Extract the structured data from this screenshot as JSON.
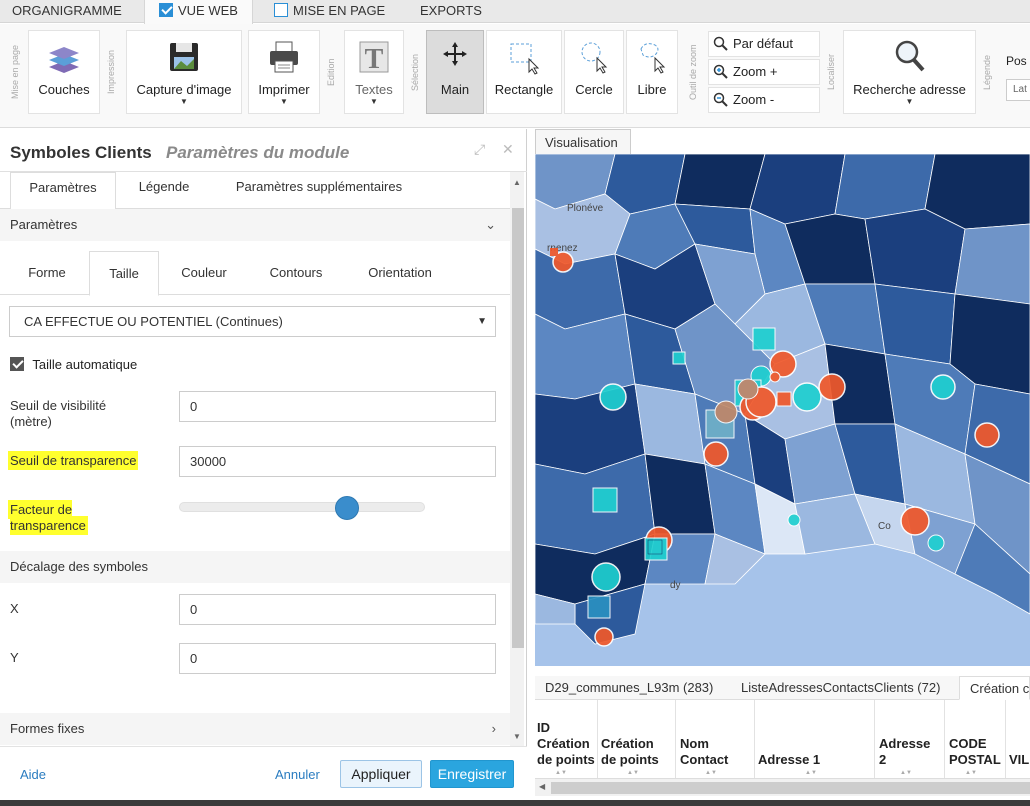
{
  "top_tabs": [
    {
      "label": "ORGANIGRAMME"
    },
    {
      "label": "VUE WEB"
    },
    {
      "label": "MISE EN PAGE"
    },
    {
      "label": "EXPORTS"
    }
  ],
  "ribbon": {
    "groups": {
      "mise_en_page": "Mise en page",
      "impression": "Impression",
      "edition": "Edition",
      "selection": "Sélection",
      "outil_de_zoom": "Outil de zoom",
      "localiser": "Localiser",
      "legende": "Légende"
    },
    "couches": "Couches",
    "capture": "Capture d'image",
    "imprimer": "Imprimer",
    "textes": "Textes",
    "main": "Main",
    "rectangle": "Rectangle",
    "cercle": "Cercle",
    "libre": "Libre",
    "par_defaut": "Par défaut",
    "zoom_plus": "Zoom +",
    "zoom_moins": "Zoom -",
    "recherche": "Recherche adresse",
    "pos_label": "Pos",
    "pos_value": "Lat"
  },
  "panel": {
    "title": "Symboles Clients",
    "subtitle": "Paramètres du module",
    "tabs": [
      "Paramètres",
      "Légende",
      "Paramètres supplémentaires"
    ],
    "section_params": "Paramètres",
    "inner_tabs": [
      "Forme",
      "Taille",
      "Couleur",
      "Contours",
      "Orientation"
    ],
    "select_value": "CA EFFECTUE OU POTENTIEL (Continues)",
    "auto_size_label": "Taille automatique",
    "visibility_label": "Seuil de visibilité (mètre)",
    "visibility_value": "0",
    "transparency_threshold_label": "Seuil de transparence",
    "transparency_threshold_value": "30000",
    "transparency_factor_label": "Facteur de transparence",
    "transparency_factor_value": 0.7,
    "offset_section": "Décalage des symboles",
    "x_label": "X",
    "x_value": "0",
    "y_label": "Y",
    "y_value": "0",
    "fixed_shapes": "Formes fixes",
    "footer": {
      "help": "Aide",
      "cancel": "Annuler",
      "apply": "Appliquer",
      "save": "Enregistrer"
    }
  },
  "map": {
    "tab": "Visualisation",
    "labels": [
      "Plonéve",
      "rnenez",
      "Co",
      "dy"
    ],
    "colors": {
      "sea": "#a6c3ea",
      "dark": "#0f2c5e",
      "orange": "#f0582a",
      "cyan": "#1fcfd0"
    }
  },
  "table": {
    "tabs": [
      "D29_communes_L93m (283)",
      "ListeAdressesContactsClients (72)",
      "Création c"
    ],
    "headers": [
      "ID Création de points",
      "Création de points",
      "Nom Contact",
      "Adresse 1",
      "Adresse 2",
      "CODE POSTAL",
      "VIL"
    ]
  }
}
